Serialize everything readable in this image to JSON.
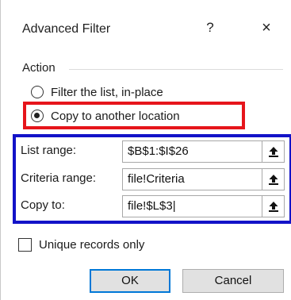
{
  "dialog": {
    "title": "Advanced Filter",
    "help_glyph": "?",
    "close_glyph": "×"
  },
  "action": {
    "group_label": "Action",
    "options": [
      {
        "label": "Filter the list, in-place",
        "checked": false
      },
      {
        "label": "Copy to another location",
        "checked": true
      }
    ]
  },
  "fields": {
    "list_range": {
      "label": "List range:",
      "value": "$B$1:$I$26"
    },
    "criteria_range": {
      "label": "Criteria range:",
      "value": "file!Criteria"
    },
    "copy_to": {
      "label": "Copy to:",
      "value": "file!$L$3"
    }
  },
  "unique": {
    "label": "Unique records only",
    "checked": false
  },
  "buttons": {
    "ok": "OK",
    "cancel": "Cancel"
  },
  "colors": {
    "highlight_red": "#e6151b",
    "highlight_blue": "#1313c8",
    "default_button_border": "#0078d7"
  },
  "icons": {
    "collapse": "collapse-dialog-icon",
    "radio": "radio-icon",
    "checkbox": "checkbox-icon"
  }
}
